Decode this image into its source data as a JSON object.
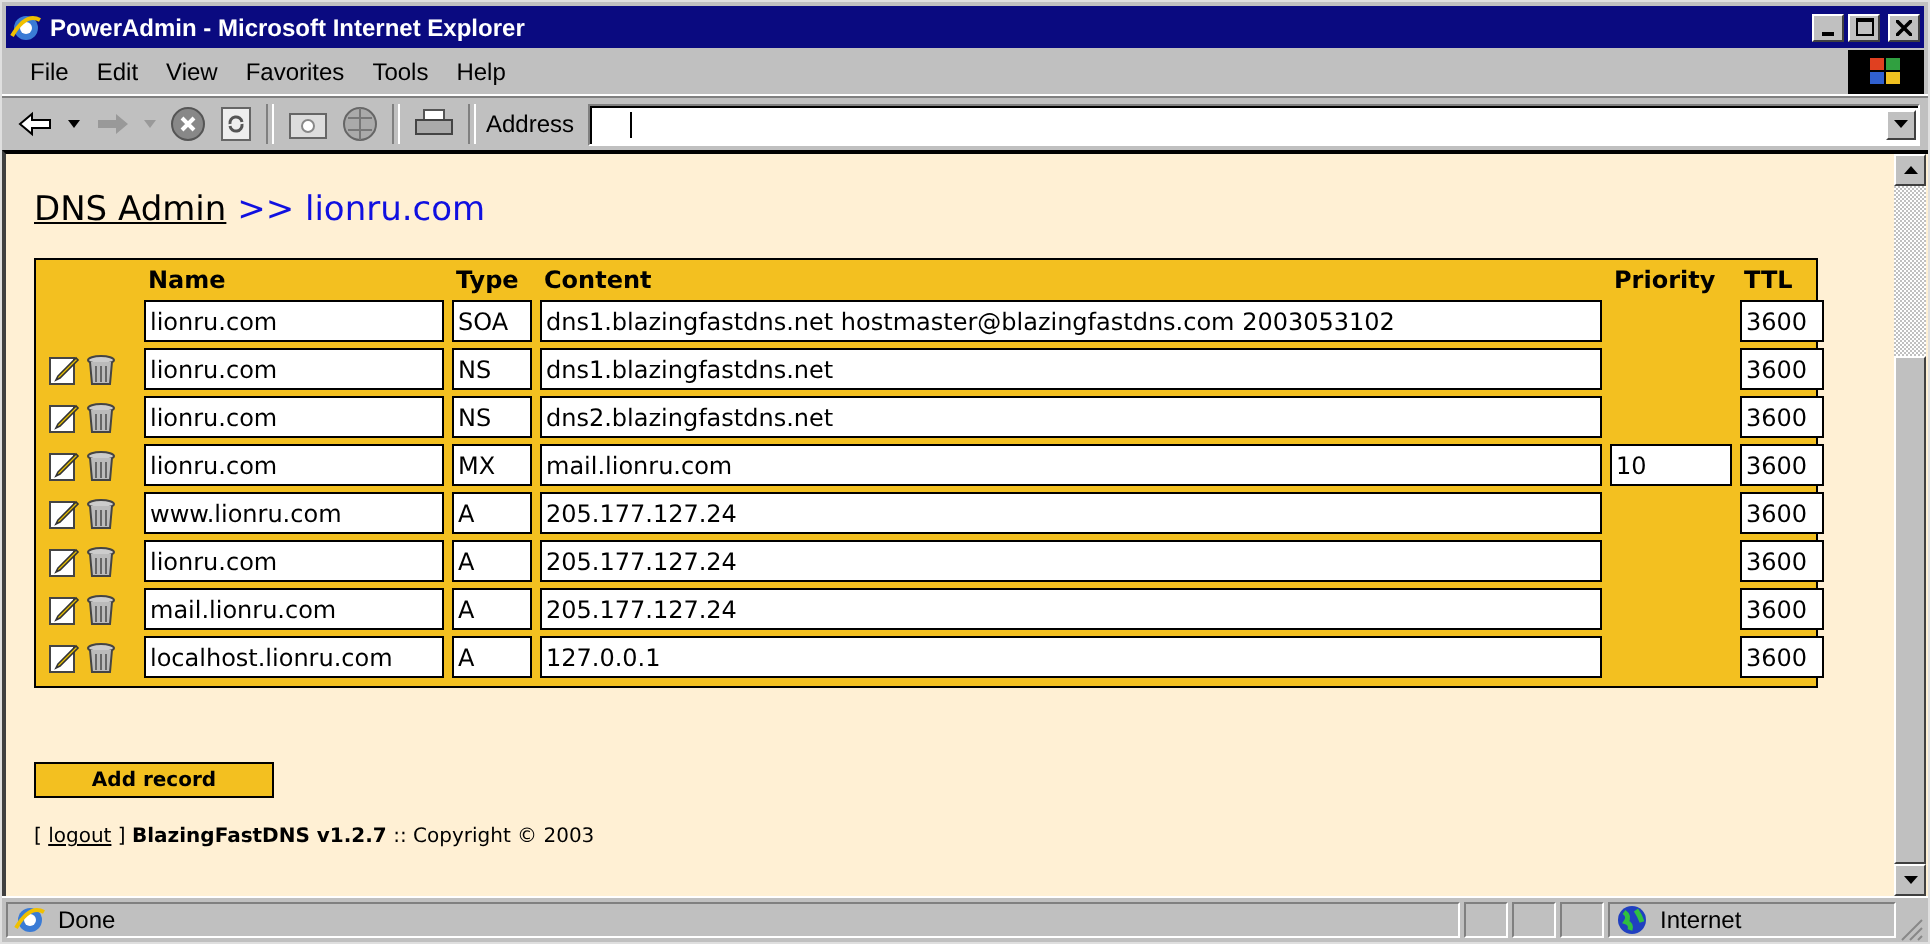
{
  "window": {
    "title": "PowerAdmin - Microsoft Internet Explorer"
  },
  "menu": [
    "File",
    "Edit",
    "View",
    "Favorites",
    "Tools",
    "Help"
  ],
  "address_bar": {
    "label": "Address"
  },
  "breadcrumb": {
    "link": "DNS Admin",
    "current": ">> lionru.com"
  },
  "table": {
    "columns": [
      "Name",
      "Type",
      "Content",
      "Priority",
      "TTL"
    ],
    "rows": [
      {
        "actions": false,
        "name": "lionru.com",
        "type": "SOA",
        "content": "dns1.blazingfastdns.net hostmaster@blazingfastdns.com 2003053102",
        "ttl": "3600"
      },
      {
        "actions": true,
        "name": "lionru.com",
        "type": "NS",
        "content": "dns1.blazingfastdns.net",
        "ttl": "3600"
      },
      {
        "actions": true,
        "name": "lionru.com",
        "type": "NS",
        "content": "dns2.blazingfastdns.net",
        "ttl": "3600"
      },
      {
        "actions": true,
        "name": "lionru.com",
        "type": "MX",
        "content": "mail.lionru.com",
        "priority": "10",
        "ttl": "3600"
      },
      {
        "actions": true,
        "name": "www.lionru.com",
        "type": "A",
        "content": "205.177.127.24",
        "ttl": "3600"
      },
      {
        "actions": true,
        "name": "lionru.com",
        "type": "A",
        "content": "205.177.127.24",
        "ttl": "3600"
      },
      {
        "actions": true,
        "name": "mail.lionru.com",
        "type": "A",
        "content": "205.177.127.24",
        "ttl": "3600"
      },
      {
        "actions": true,
        "name": "localhost.lionru.com",
        "type": "A",
        "content": "127.0.0.1",
        "ttl": "3600"
      }
    ]
  },
  "add_button": "Add record",
  "footer": {
    "open": "[",
    "link": "logout",
    "rest": "] **BlazingFastDNS v1.2.7** :: Copyright © 2003"
  },
  "status_bar": {
    "text": "Done",
    "zone": "Internet"
  }
}
